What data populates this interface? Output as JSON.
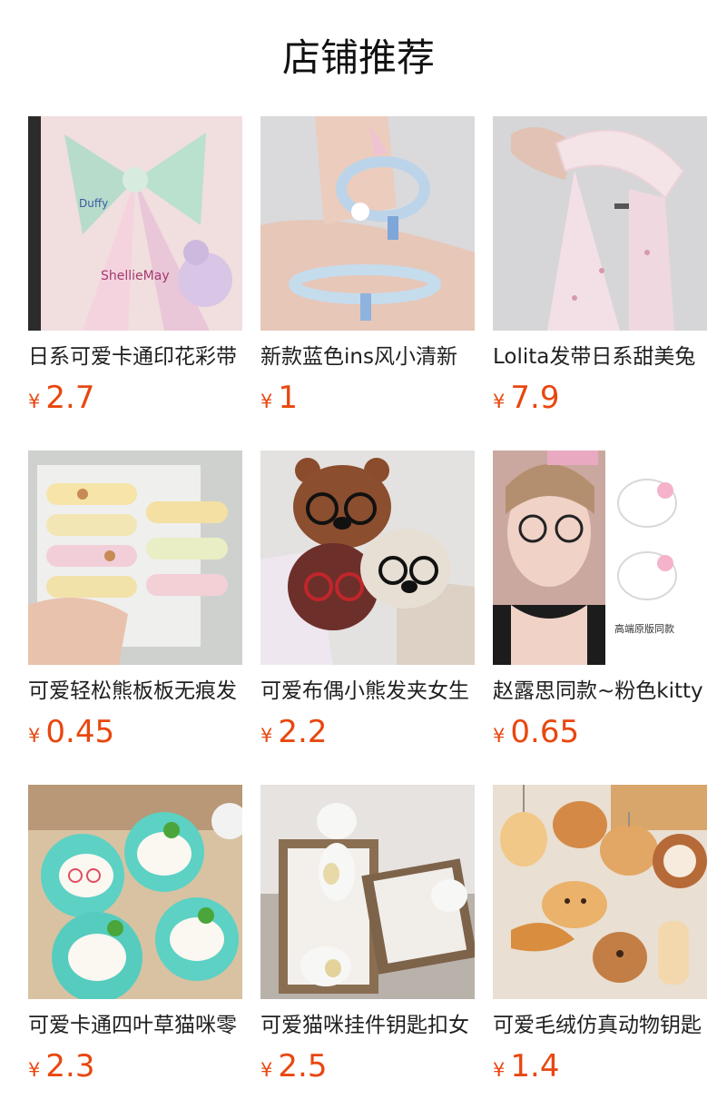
{
  "header": {
    "title": "店铺推荐"
  },
  "products": [
    {
      "name": "日系可爱卡通印花彩带",
      "currency": "¥",
      "price": "2.7",
      "image": "printed-ribbon-photo"
    },
    {
      "name": "新款蓝色ins风小清新",
      "currency": "¥",
      "price": "1",
      "image": "blue-coil-bracelet-photo"
    },
    {
      "name": "Lolita发带日系甜美兔",
      "currency": "¥",
      "price": "7.9",
      "image": "lolita-headband-photo"
    },
    {
      "name": "可爱轻松熊板板无痕发",
      "currency": "¥",
      "price": "0.45",
      "image": "bear-hairclip-photo"
    },
    {
      "name": "可爱布偶小熊发夹女生",
      "currency": "¥",
      "price": "2.2",
      "image": "plush-bear-clip-photo"
    },
    {
      "name": "赵露思同款~粉色kitty",
      "currency": "¥",
      "price": "0.65",
      "image": "kitty-hairclip-photo"
    },
    {
      "name": "可爱卡通四叶草猫咪零",
      "currency": "¥",
      "price": "2.3",
      "image": "clover-cat-purse-photo"
    },
    {
      "name": "可爱猫咪挂件钥匙扣女",
      "currency": "¥",
      "price": "2.5",
      "image": "cat-keychain-photo"
    },
    {
      "name": "可爱毛绒仿真动物钥匙",
      "currency": "¥",
      "price": "1.4",
      "image": "bread-animal-keychain-photo"
    }
  ],
  "colors": {
    "price": "#e8470f",
    "title": "#111111",
    "name": "#1f1f1f"
  }
}
